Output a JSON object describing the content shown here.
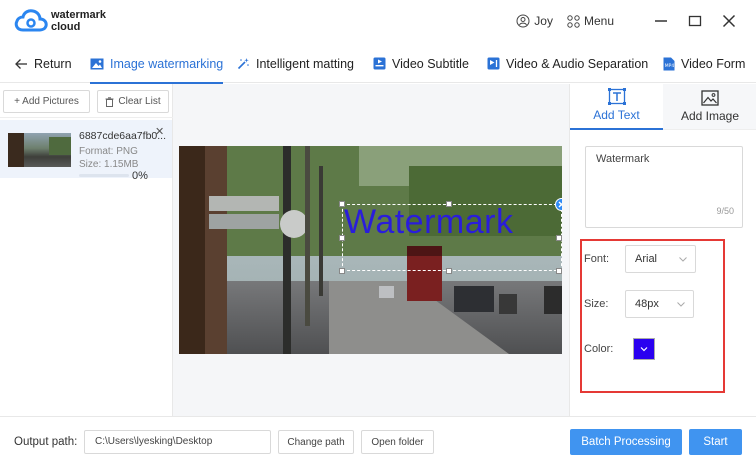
{
  "app": {
    "logo_line1": "watermark",
    "logo_line2": "cloud",
    "user_name": "Joy",
    "menu_label": "Menu",
    "accent_color": "#2b72d6"
  },
  "tabs": [
    {
      "label": "Return",
      "icon": "arrow-left-icon"
    },
    {
      "label": "Image watermarking",
      "icon": "image-icon",
      "active": true
    },
    {
      "label": "Intelligent matting",
      "icon": "magic-wand-icon"
    },
    {
      "label": "Video Subtitle",
      "icon": "video-subtitle-icon"
    },
    {
      "label": "Video & Audio Separation",
      "icon": "audio-separation-icon"
    },
    {
      "label": "Video Form",
      "icon": "video-format-icon"
    }
  ],
  "left_panel": {
    "add_pictures": "+ Add Pictures",
    "clear_list": "Clear List",
    "file": {
      "name": "6887cde6aa7fb0...",
      "format": "Format:  PNG",
      "size": "Size:  1.15MB",
      "progress": "0%"
    }
  },
  "canvas": {
    "watermark_text": "Watermark",
    "watermark_color": "#2a1ddb"
  },
  "right_panel": {
    "tabs": [
      {
        "label": "Add Text",
        "icon": "text-icon",
        "active": true
      },
      {
        "label": "Add Image",
        "icon": "image-icon"
      }
    ],
    "text_value": "Watermark",
    "char_count": "9/50",
    "font_label": "Font:",
    "font_value": "Arial",
    "size_label": "Size:",
    "size_value": "48px",
    "color_label": "Color:",
    "color_value": "#2a00f0"
  },
  "bottom": {
    "output_label": "Output path:",
    "output_path": "C:\\Users\\lyesking\\Desktop",
    "change_path": "Change path",
    "open_folder": "Open folder",
    "batch_processing": "Batch Processing",
    "start": "Start"
  }
}
